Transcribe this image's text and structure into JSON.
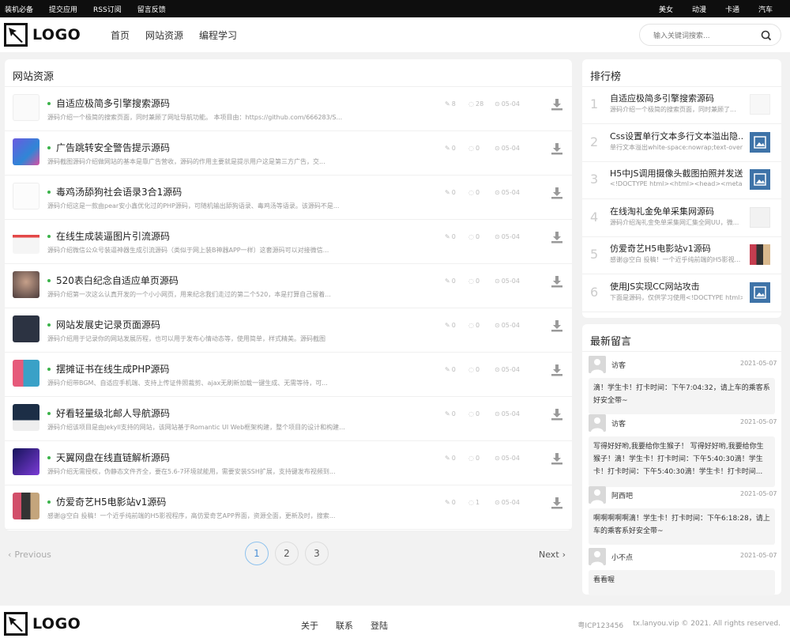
{
  "topbar": {
    "left": [
      "装机必备",
      "提交应用",
      "RSS订阅",
      "留言反馈"
    ],
    "right": [
      "美女",
      "动漫",
      "卡通",
      "汽车"
    ]
  },
  "logo": {
    "text": "LOGO"
  },
  "nav": [
    "首页",
    "网站资源",
    "编程学习"
  ],
  "search": {
    "placeholder": "输入关键词搜索..."
  },
  "main": {
    "title": "网站资源",
    "articles": [
      {
        "title": "自适应极简多引擎搜索源码",
        "desc": "源码介绍一个极简的搜索页面，同时兼顾了网址导航功能。 本项目由：https://github.com/666283/S...",
        "views": "8",
        "comments": "28",
        "date": "05-04"
      },
      {
        "title": "广告跳转安全警告提示源码",
        "desc": "源码截图源码介绍做网站的基本是靠广告营收，源码的作用主要就是提示用户这是第三方广告，交...",
        "views": "0",
        "comments": "0",
        "date": "05-04"
      },
      {
        "title": "毒鸡汤舔狗社会语录3合1源码",
        "desc": "源码介绍这是一款由pear安小鑫优化过的PHP源码，可随机输出舔狗语录、毒鸡汤等语录。该源码不是...",
        "views": "0",
        "comments": "0",
        "date": "05-04"
      },
      {
        "title": "在线生成装逼图片引流源码",
        "desc": "源码介绍微信公众号装逼神器生成引流源码（类似于网上装B神器APP一样）这套源码可以对接微信...",
        "views": "0",
        "comments": "0",
        "date": "05-04"
      },
      {
        "title": "520表白纪念自适应单页源码",
        "desc": "源码介绍第一次这么认真开发的一个小小网页，用来纪念我们走过的第二个520，本是打算自己留着...",
        "views": "0",
        "comments": "0",
        "date": "05-04"
      },
      {
        "title": "网站发展史记录页面源码",
        "desc": "源码介绍用于记录你的网站发展历程，也可以用于发布心情动态等，使用简单，样式精美。源码截图",
        "views": "0",
        "comments": "0",
        "date": "05-04"
      },
      {
        "title": "摆摊证书在线生成PHP源码",
        "desc": "源码介绍带BGM、自适应手机端、支持上传证件照裁剪、ajax无刷新加载一键生成、无需等待，可...",
        "views": "0",
        "comments": "0",
        "date": "05-04"
      },
      {
        "title": "好看轻量级北邮人导航源码",
        "desc": "源码介绍该项目是由Jekyll支持的网站，该网站基于Romantic UI Web框架构建，整个项目的设计和构建...",
        "views": "0",
        "comments": "0",
        "date": "05-04"
      },
      {
        "title": "天翼网盘在线直链解析源码",
        "desc": "源码介绍无需授权，伪静态文件齐全，要在5.6-7环境就能用，需要安装SSH扩展，支持键发布视频到...",
        "views": "0",
        "comments": "0",
        "date": "05-04"
      },
      {
        "title": "仿爱奇艺H5电影站v1源码",
        "desc": "感谢@空白 投稿！一个近乎纯前端的H5影视程序，高仿爱奇艺APP界面，资源全面，更新及时，搜索...",
        "views": "0",
        "comments": "1",
        "date": "05-04"
      }
    ]
  },
  "pager": {
    "prev": "Previous",
    "next": "Next",
    "pages": [
      "1",
      "2",
      "3"
    ],
    "current": "1"
  },
  "rank": {
    "title": "排行榜",
    "items": [
      {
        "num": "1",
        "title": "自适应极简多引擎搜索源码",
        "desc": "源码介绍一个极简的搜索页面，同时兼顾了..."
      },
      {
        "num": "2",
        "title": "Css设置单行文本多行文本溢出隐...",
        "desc": "单行文本溢出white-space:nowrap;text-overflo..."
      },
      {
        "num": "3",
        "title": "H5中JS调用摄像头截图拍照并发送",
        "desc": "<!DOCTYPE html><html><head><meta http-equiv..."
      },
      {
        "num": "4",
        "title": "在线淘礼金免单采集网源码",
        "desc": "源码介绍淘礼金免单采集网汇集全网UU，微..."
      },
      {
        "num": "5",
        "title": "仿爱奇艺H5电影站v1源码",
        "desc": "感谢@空白 投稿！一个近乎纯前端的H5影视..."
      },
      {
        "num": "6",
        "title": "使用JS实现CC网站攻击",
        "desc": "下面是源码，仅供学习使用<!DOCTYPE html><..."
      }
    ]
  },
  "messages": {
    "title": "最新留言",
    "items": [
      {
        "name": "访客",
        "date": "2021-05-07",
        "text": "滴！学生卡！打卡时间：下午7:04:32，请上车的乘客系好安全带~"
      },
      {
        "name": "访客",
        "date": "2021-05-07",
        "text": "写得好好哟,我要给你生猴子！ 写得好好哟,我要给你生猴子！滴！学生卡！打卡时间：下午5:40:30滴！学生卡！打卡时间：下午5:40:30滴！学生卡！打卡时间..."
      },
      {
        "name": "阿西吧",
        "date": "2021-05-07",
        "text": "啊啊啊啊啊滴！学生卡！打卡时间：下午6:18:28，请上车的乘客系好安全带~"
      },
      {
        "name": "小不点",
        "date": "2021-05-07",
        "text": "看看喔"
      }
    ]
  },
  "footer": {
    "logo": "LOGO",
    "links": [
      "关于",
      "联系",
      "登陆"
    ],
    "icp": "粤ICP123456",
    "copyright": "tx.lanyou.vip © 2021. All rights reserved."
  },
  "colors": {
    "accent_green": "#3bb34a",
    "pager_active": "#4a8fd6",
    "topbar": "#0e0e0e"
  }
}
